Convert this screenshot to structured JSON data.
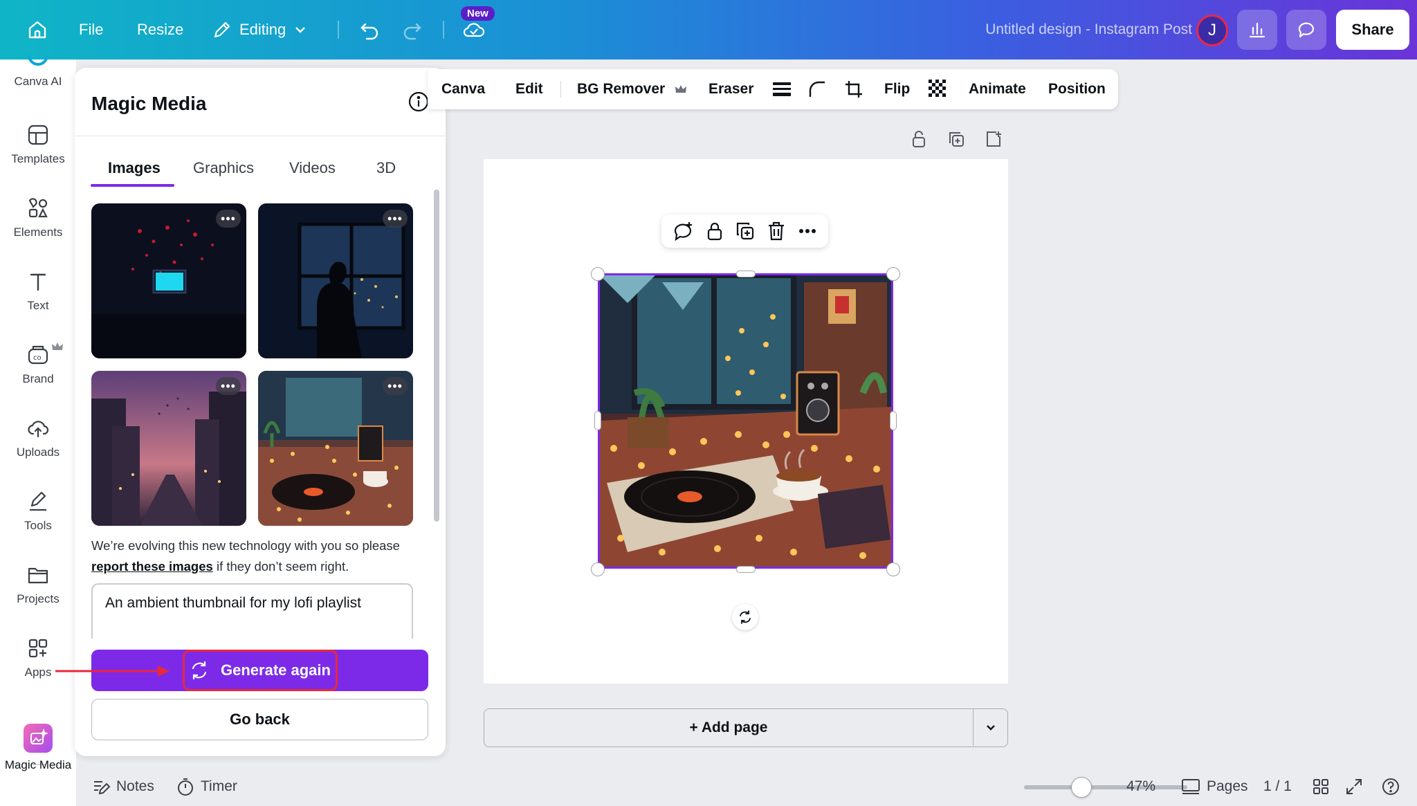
{
  "topbar": {
    "file_label": "File",
    "resize_label": "Resize",
    "editing_label": "Editing",
    "new_badge": "New",
    "design_title": "Untitled design - Instagram Post",
    "avatar_initial": "J",
    "share_label": "Share",
    "gradient": [
      "#0fb5c6",
      "#6a34d9"
    ]
  },
  "rail": {
    "items": [
      {
        "label": "Canva AI",
        "icon": "canva-ai-icon"
      },
      {
        "label": "Templates",
        "icon": "templates-icon"
      },
      {
        "label": "Elements",
        "icon": "elements-icon"
      },
      {
        "label": "Text",
        "icon": "text-icon"
      },
      {
        "label": "Brand",
        "icon": "brand-icon"
      },
      {
        "label": "Uploads",
        "icon": "uploads-icon"
      },
      {
        "label": "Tools",
        "icon": "tools-icon"
      },
      {
        "label": "Projects",
        "icon": "projects-icon"
      },
      {
        "label": "Apps",
        "icon": "apps-icon"
      },
      {
        "label": "Magic Media",
        "icon": "magic-media-icon"
      }
    ]
  },
  "panel": {
    "title": "Magic Media",
    "tabs": [
      {
        "label": "Images",
        "active": true
      },
      {
        "label": "Graphics",
        "active": false
      },
      {
        "label": "Videos",
        "active": false
      },
      {
        "label": "3D",
        "active": false
      }
    ],
    "disclaimer_before": "We’re evolving this new technology with you so please ",
    "disclaimer_link": "report these images",
    "disclaimer_after": " if they don’t seem right.",
    "prompt": "An ambient thumbnail for my lofi playlist",
    "generate_label": "Generate again",
    "goback_label": "Go back",
    "accent": "#7d2ae8"
  },
  "context_toolbar": {
    "items": [
      "Canva",
      "Edit",
      "BG Remover",
      "Eraser",
      "Flip",
      "Animate",
      "Position"
    ]
  },
  "canvas": {
    "add_page_label": "+ Add page"
  },
  "bottombar": {
    "notes_label": "Notes",
    "timer_label": "Timer",
    "zoom_label": "47%",
    "zoom_fraction": 0.35,
    "pages_label": "Pages",
    "page_count": "1 / 1"
  }
}
